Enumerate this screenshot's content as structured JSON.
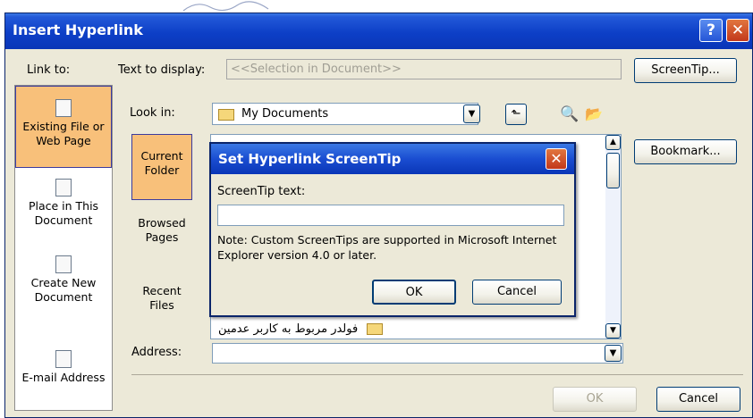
{
  "dialog": {
    "title": "Insert Hyperlink",
    "help_icon": "question-icon",
    "close_icon": "close-icon",
    "link_to_label": "Link to:",
    "text_to_display_label": "Text to display:",
    "text_to_display_value": "<<Selection in Document>>",
    "screentip_button": "ScreenTip...",
    "look_in_label": "Look in:",
    "look_in_value": "My Documents",
    "bookmark_button": "Bookmark...",
    "address_label": "Address:",
    "address_value": "",
    "ok_button": "OK",
    "cancel_button": "Cancel"
  },
  "link_to": [
    {
      "label": "Existing File or Web Page",
      "icon": "document-globe-icon",
      "selected": true
    },
    {
      "label": "Place in This Document",
      "icon": "document-place-icon",
      "selected": false
    },
    {
      "label": "Create New Document",
      "icon": "new-document-icon",
      "selected": false
    },
    {
      "label": "E-mail Address",
      "icon": "email-icon",
      "selected": false
    }
  ],
  "browse": [
    {
      "label": "Current Folder",
      "selected": true
    },
    {
      "label": "Browsed Pages",
      "selected": false
    },
    {
      "label": "Recent Files",
      "selected": false
    }
  ],
  "file_list": {
    "visible_items": [
      "فولدر مربوط به کاربر عدمين"
    ]
  },
  "screentip_dialog": {
    "title": "Set Hyperlink ScreenTip",
    "close_icon": "close-icon",
    "field_label": "ScreenTip text:",
    "field_value": "",
    "note": "Note: Custom ScreenTips are supported in Microsoft Internet Explorer version 4.0 or later.",
    "ok_button": "OK",
    "cancel_button": "Cancel"
  }
}
